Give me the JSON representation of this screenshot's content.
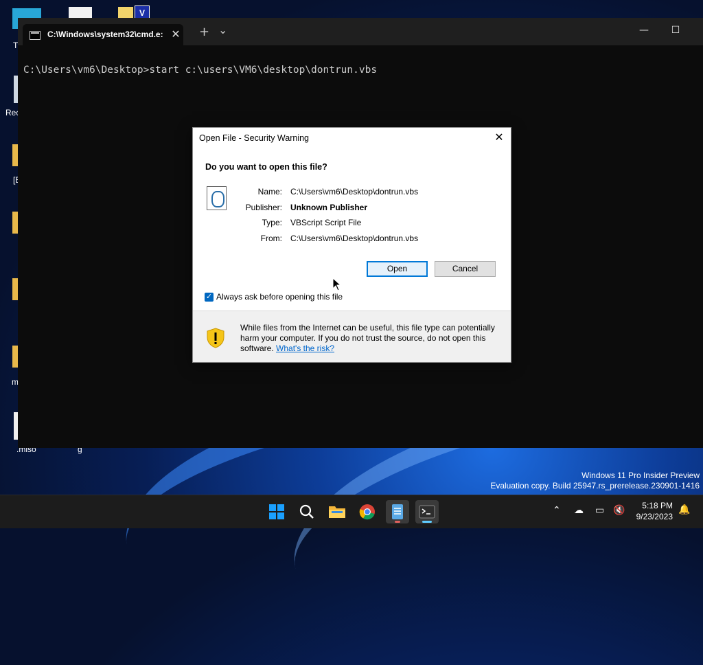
{
  "desktop": {
    "labels": [
      "T",
      "Rec",
      "[E",
      "m",
      ".miso",
      "g"
    ]
  },
  "terminal": {
    "tab_title": "C:\\Windows\\system32\\cmd.e:",
    "new_tab": "+",
    "dropdown": "⌄",
    "close_tab": "✕",
    "minimize": "—",
    "maximize": "☐",
    "command_line": "C:\\Users\\vm6\\Desktop>start c:\\users\\VM6\\desktop\\dontrun.vbs"
  },
  "dialog": {
    "title": "Open File - Security Warning",
    "close": "✕",
    "question": "Do you want to open this file?",
    "fields": [
      {
        "label": "Name:",
        "value": "C:\\Users\\vm6\\Desktop\\dontrun.vbs"
      },
      {
        "label": "Publisher:",
        "value": "Unknown Publisher"
      },
      {
        "label": "Type:",
        "value": "VBScript Script File"
      },
      {
        "label": "From:",
        "value": "C:\\Users\\vm6\\Desktop\\dontrun.vbs"
      }
    ],
    "open_button": "Open",
    "cancel_button": "Cancel",
    "checkbox_label": "Always ask before opening this file",
    "checkbox_checked": true,
    "warning_text": "While files from the Internet can be useful, this file type can potentially harm your computer. If you do not trust the source, do not open this software.",
    "warning_link": "What's the risk?"
  },
  "watermark": {
    "line1": "Windows 11 Pro Insider Preview",
    "line2": "Evaluation copy. Build 25947.rs_prerelease.230901-1416"
  },
  "taskbar": {
    "apps": [
      "start-icon",
      "search-icon",
      "file-explorer-icon",
      "chrome-icon",
      "notepad-icon",
      "terminal-icon"
    ],
    "time": "5:18 PM",
    "date": "9/23/2023"
  },
  "colors": {
    "accent": "#0078d7",
    "terminal_bg": "#0c0c0c",
    "taskbar_bg": "#1c1c1c"
  }
}
